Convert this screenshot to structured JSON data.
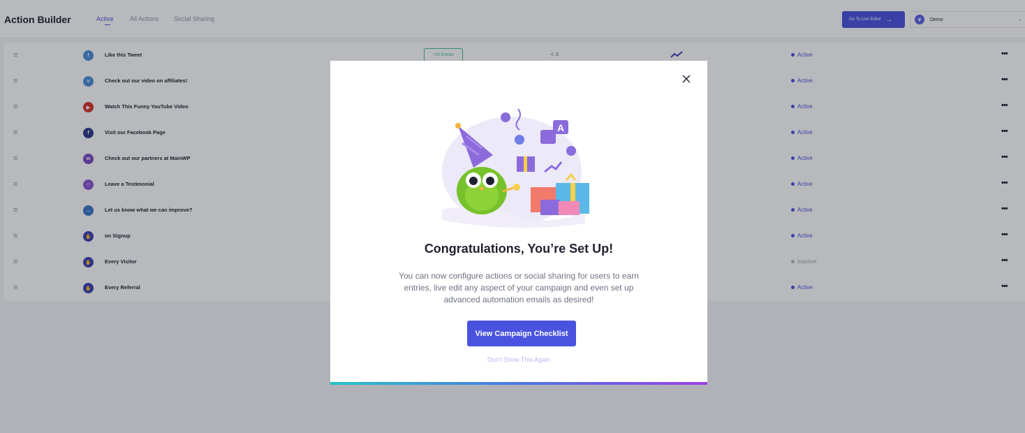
{
  "header": {
    "app_title": "Action Builder",
    "tabs": [
      {
        "label": "Active",
        "active": true
      },
      {
        "label": "All Actions",
        "active": false
      },
      {
        "label": "Social Sharing",
        "active": false
      }
    ],
    "live_editor_label": "Go To Live Editor",
    "campaign_select": {
      "value": "Demo"
    }
  },
  "actions": [
    {
      "label": "Like this Tweet",
      "icon": "twitter-icon",
      "color": "#4a90d9",
      "status": "Active",
      "entries": "+10 Entries",
      "shares": "3"
    },
    {
      "label": "Check out our video on affiliates!",
      "icon": "vimeo-icon",
      "color": "#4a90d9",
      "status": "Active"
    },
    {
      "label": "Watch This Funny YouTube Video",
      "icon": "youtube-icon",
      "color": "#d9302a",
      "status": "Active"
    },
    {
      "label": "Visit our Facebook Page",
      "icon": "facebook-icon",
      "color": "#2e3a8c",
      "status": "Active"
    },
    {
      "label": "Check out our partners at MainWP",
      "icon": "mainwp-icon",
      "color": "#7a49c8",
      "status": "Active"
    },
    {
      "label": "Leave a Testimonial",
      "icon": "testimonial-icon",
      "color": "#8a55d6",
      "status": "Active"
    },
    {
      "label": "Let us know what we can improve?",
      "icon": "feedback-icon",
      "color": "#3a74c8",
      "status": "Active"
    },
    {
      "label": "on Signup",
      "icon": "signup-icon",
      "color": "#3b3fb5",
      "status": "Active"
    },
    {
      "label": "Every Visitor",
      "icon": "visitor-icon",
      "color": "#3b3fb5",
      "status": "Inactive"
    },
    {
      "label": "Every Referral",
      "icon": "referral-icon",
      "color": "#3b3fb5",
      "status": "Active"
    }
  ],
  "modal": {
    "title": "Congratulations, You’re Set Up!",
    "body": "You can now configure actions or social sharing for users to earn entries, live edit any aspect of your campaign and even set up advanced automation emails as desired!",
    "cta_label": "View Campaign Checklist",
    "dismiss_label": "Don't Show This Again"
  },
  "colors": {
    "accent": "#4a53e0",
    "success": "#3fbf8a"
  }
}
